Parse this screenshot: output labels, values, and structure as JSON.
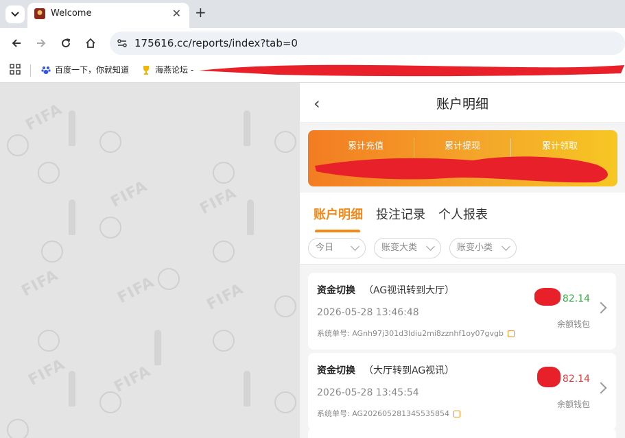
{
  "browser": {
    "tab_title": "Welcome",
    "close_glyph": "✕",
    "new_tab_glyph": "+",
    "url": "175616.cc/reports/index?tab=0",
    "bookmarks": [
      {
        "label": "百度一下，你就知道",
        "icon": "baidu-paw-icon"
      },
      {
        "label": "海燕论坛 -",
        "icon": "trophy-icon"
      }
    ]
  },
  "page": {
    "title": "账户明细",
    "back_glyph": "‹",
    "summary": {
      "labels": [
        "累计充值",
        "累计提现",
        "累计领取"
      ]
    },
    "tabs": [
      {
        "label": "账户明细",
        "active": true
      },
      {
        "label": "投注记录",
        "active": false
      },
      {
        "label": "个人报表",
        "active": false
      }
    ],
    "filters": [
      "今日",
      "账变大类",
      "账变小类"
    ],
    "records": [
      {
        "type": "资金切换",
        "detail": "（AG视讯转到大厅）",
        "time": "2026-05-28 13:46:48",
        "order_label": "系统单号:",
        "order_no": "AGnh97j301d3ldiu2mi8zznhf1oy07gvgb",
        "amount_visible": "82.14",
        "amount_color": "#3aa84a",
        "wallet": "余额钱包"
      },
      {
        "type": "资金切换",
        "detail": "（大厅转到AG视讯）",
        "time": "2026-05-28 13:45:54",
        "order_label": "系统单号:",
        "order_no": "AG202605281345535854",
        "amount_visible": "82.14",
        "amount_color": "#e04040",
        "wallet": "余额钱包"
      }
    ],
    "accent_color": "#f28a1b",
    "redaction_color": "#e8202a"
  }
}
